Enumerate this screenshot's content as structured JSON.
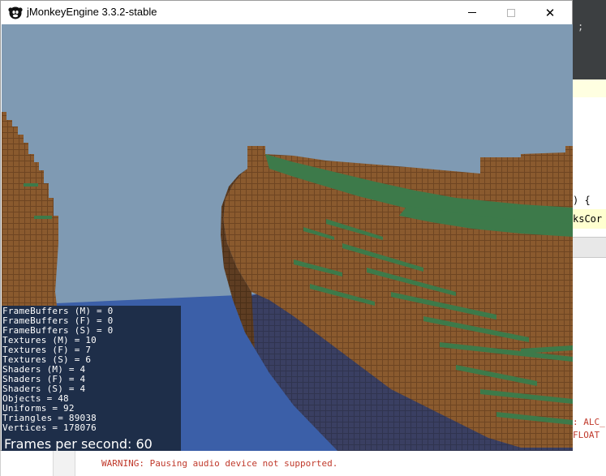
{
  "window": {
    "title": "jMonkeyEngine 3.3.2-stable",
    "minimize_label": "",
    "maximize_label": "",
    "close_label": "✕"
  },
  "stats": [
    "FrameBuffers (M) = 0",
    "FrameBuffers (F) = 0",
    "FrameBuffers (S) = 0",
    "Textures (M) = 10",
    "Textures (F) = 7",
    "Textures (S) = 6",
    "Shaders (M) = 4",
    "Shaders (F) = 4",
    "Shaders (S) = 4",
    "Objects = 48",
    "Uniforms = 92",
    "Triangles = 89038",
    "Vertices = 178076"
  ],
  "fps": "Frames per second: 60",
  "ide": {
    "code_fragment_1": ";",
    "code_fragment_2": ") {",
    "code_fragment_3": "ksCor",
    "error_fragment_1": ": ALC_",
    "error_fragment_2": "FLOAT",
    "warning": "WARNING: Pausing audio device not supported."
  },
  "colors": {
    "sky": "#7f9ab3",
    "water": "#3b5fa8",
    "dirt": "#8a5a2e",
    "grass": "#3d7a4a",
    "stats_bg": "#16202e",
    "error_text": "#c0392b"
  }
}
